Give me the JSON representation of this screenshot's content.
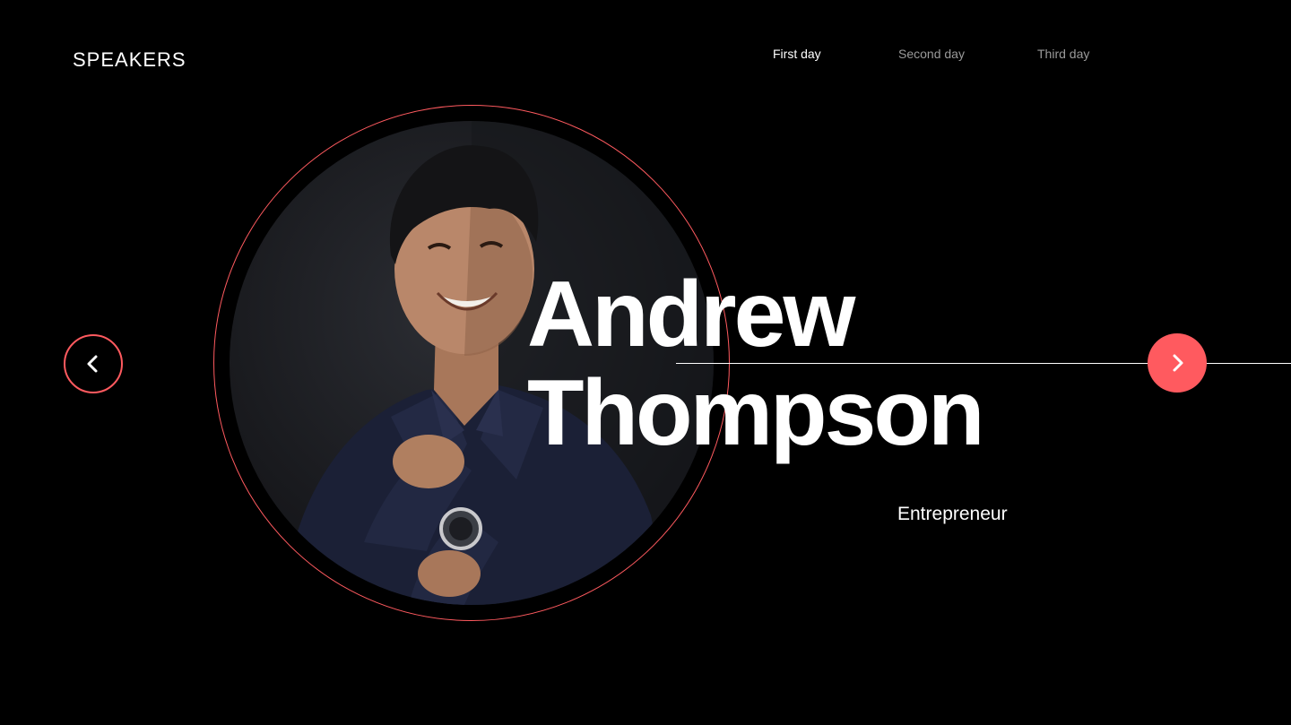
{
  "header": {
    "title": "SPEAKERS",
    "tabs": [
      {
        "label": "First day",
        "active": true
      },
      {
        "label": "Second day",
        "active": false
      },
      {
        "label": "Third day",
        "active": false
      }
    ]
  },
  "speaker": {
    "first_name": "Andrew",
    "last_name": "Thompson",
    "role": "Entrepreneur"
  },
  "controls": {
    "prev_icon": "chevron-left-icon",
    "next_icon": "chevron-right-icon"
  },
  "colors": {
    "accent": "#ff5a5f",
    "background": "#000000",
    "text": "#ffffff",
    "tab_inactive": "#9a9a9a"
  }
}
